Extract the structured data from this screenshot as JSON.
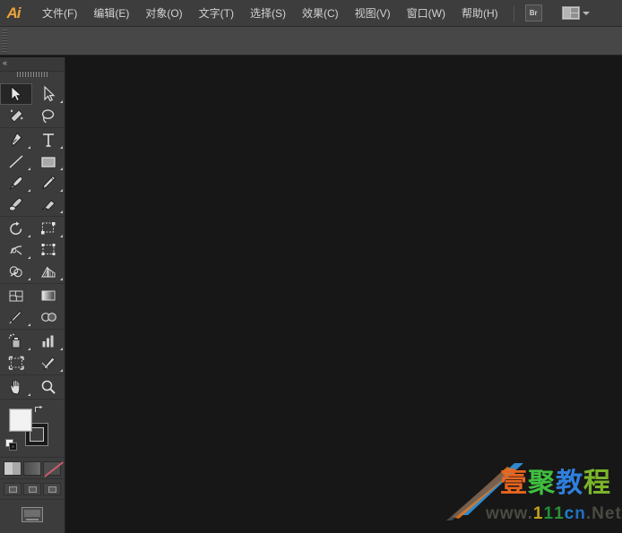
{
  "app": {
    "name": "Adobe Illustrator",
    "logo_text": "Ai"
  },
  "menubar": {
    "items": [
      {
        "label": "文件(F)",
        "name": "menu-file"
      },
      {
        "label": "编辑(E)",
        "name": "menu-edit"
      },
      {
        "label": "对象(O)",
        "name": "menu-object"
      },
      {
        "label": "文字(T)",
        "name": "menu-type"
      },
      {
        "label": "选择(S)",
        "name": "menu-select"
      },
      {
        "label": "效果(C)",
        "name": "menu-effect"
      },
      {
        "label": "视图(V)",
        "name": "menu-view"
      },
      {
        "label": "窗口(W)",
        "name": "menu-window"
      },
      {
        "label": "帮助(H)",
        "name": "menu-help"
      }
    ],
    "bridge_label": "Br",
    "arrange_documents_label": "",
    "icons": {
      "bridge": "bridge-icon",
      "arrange": "arrange-documents-icon",
      "caret": "chevron-down-icon"
    }
  },
  "controlbar": {
    "visible": true,
    "content": ""
  },
  "toolpanel": {
    "collapse_label": "«",
    "active_tool": "selection-tool",
    "groups": [
      {
        "name": "selection-group",
        "rows": [
          [
            {
              "name": "selection-tool",
              "active": true,
              "corner": false
            },
            {
              "name": "direct-selection-tool",
              "active": false,
              "corner": true
            }
          ],
          [
            {
              "name": "magic-wand-tool",
              "active": false,
              "corner": false
            },
            {
              "name": "lasso-tool",
              "active": false,
              "corner": false
            }
          ]
        ]
      },
      {
        "name": "drawing-group",
        "rows": [
          [
            {
              "name": "pen-tool",
              "active": false,
              "corner": true
            },
            {
              "name": "type-tool",
              "active": false,
              "corner": true
            }
          ],
          [
            {
              "name": "line-segment-tool",
              "active": false,
              "corner": true
            },
            {
              "name": "rectangle-tool",
              "active": false,
              "corner": true
            }
          ],
          [
            {
              "name": "paintbrush-tool",
              "active": false,
              "corner": true
            },
            {
              "name": "pencil-tool",
              "active": false,
              "corner": true
            }
          ],
          [
            {
              "name": "blob-brush-tool",
              "active": false,
              "corner": false
            },
            {
              "name": "eraser-tool",
              "active": false,
              "corner": true
            }
          ]
        ]
      },
      {
        "name": "transform-group",
        "rows": [
          [
            {
              "name": "rotate-tool",
              "active": false,
              "corner": true
            },
            {
              "name": "scale-tool",
              "active": false,
              "corner": true
            }
          ],
          [
            {
              "name": "width-tool",
              "active": false,
              "corner": true
            },
            {
              "name": "free-transform-tool",
              "active": false,
              "corner": false
            }
          ],
          [
            {
              "name": "shape-builder-tool",
              "active": false,
              "corner": true
            },
            {
              "name": "perspective-grid-tool",
              "active": false,
              "corner": true
            }
          ]
        ]
      },
      {
        "name": "symbol-group",
        "rows": [
          [
            {
              "name": "mesh-tool",
              "active": false,
              "corner": false
            },
            {
              "name": "gradient-tool",
              "active": false,
              "corner": false
            }
          ],
          [
            {
              "name": "eyedropper-tool",
              "active": false,
              "corner": true
            },
            {
              "name": "blend-tool",
              "active": false,
              "corner": false
            }
          ]
        ]
      },
      {
        "name": "symbol-graph-group",
        "rows": [
          [
            {
              "name": "symbol-sprayer-tool",
              "active": false,
              "corner": true
            },
            {
              "name": "column-graph-tool",
              "active": false,
              "corner": true
            }
          ],
          [
            {
              "name": "artboard-tool",
              "active": false,
              "corner": false
            },
            {
              "name": "slice-tool",
              "active": false,
              "corner": true
            }
          ]
        ]
      },
      {
        "name": "navigation-group",
        "rows": [
          [
            {
              "name": "hand-tool",
              "active": false,
              "corner": true
            },
            {
              "name": "zoom-tool",
              "active": false,
              "corner": false
            }
          ]
        ]
      }
    ],
    "colors": {
      "fill_label": "Fill",
      "fill_color": "#f2f2f2",
      "stroke_label": "Stroke",
      "stroke_color": "#1a1a1a",
      "swap_icon": "swap-fill-stroke-icon",
      "default_icon": "default-fill-stroke-icon"
    },
    "mode_buttons": [
      {
        "name": "color-mode-button",
        "label": ""
      },
      {
        "name": "gradient-mode-button",
        "label": ""
      },
      {
        "name": "none-mode-button",
        "label": ""
      }
    ],
    "draw_modes": [
      {
        "name": "draw-normal-button",
        "label": ""
      },
      {
        "name": "draw-behind-button",
        "label": ""
      },
      {
        "name": "draw-inside-button",
        "label": ""
      }
    ],
    "screen_mode": {
      "name": "change-screen-mode-button",
      "label": ""
    }
  },
  "canvas": {
    "background_color": "#171717",
    "document_open": false
  },
  "watermark": {
    "brand_chars": [
      {
        "ch": "壹",
        "color": "#e8641f"
      },
      {
        "ch": "聚",
        "color": "#3fbf3f"
      },
      {
        "ch": "教",
        "color": "#2f7fdd"
      },
      {
        "ch": "程",
        "color": "#7ab52a"
      }
    ],
    "url_parts": [
      {
        "text": "www.",
        "color": "#4a4a42"
      },
      {
        "text": "1",
        "color": "#c2a21a"
      },
      {
        "text": "1",
        "color": "#1f8f3a"
      },
      {
        "text": "1",
        "color": "#2f8f3a"
      },
      {
        "text": "c",
        "color": "#1f7fd0"
      },
      {
        "text": "n",
        "color": "#1f6fc0"
      },
      {
        "text": ".",
        "color": "#4a4a42"
      },
      {
        "text": "N",
        "color": "#4a4a42"
      },
      {
        "text": "e",
        "color": "#4a4a42"
      },
      {
        "text": "t",
        "color": "#4a4a42"
      }
    ],
    "swoosh_colors": [
      "#2f8fd8",
      "#e07820",
      "#6f6f6f"
    ]
  }
}
